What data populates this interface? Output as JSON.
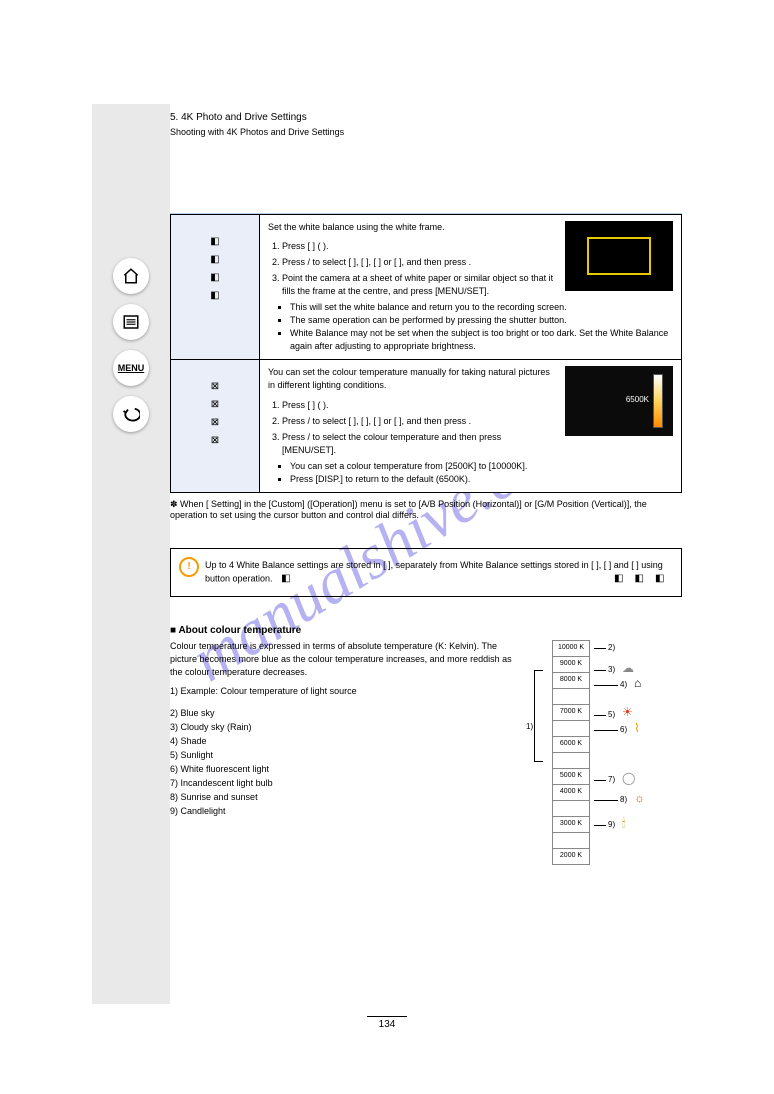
{
  "header": {
    "section": "5. 4K Photo and Drive Settings",
    "sub": "Shooting with 4K Photos and Drive Settings"
  },
  "table": {
    "row1": {
      "labels": [
        "1",
        "2",
        "3",
        "4"
      ],
      "title": "Set the white balance using the white frame.",
      "steps": [
        "Press [ ] ( ).",
        "Press / to select [ ], [ ], [ ] or [ ], and then press .",
        "Point the camera at a sheet of white paper or similar object so that it fills the frame at the centre, and press [MENU/SET].",
        "This will set the white balance and return you to the recording screen.",
        "The same operation can be performed by pressing the shutter button.",
        "White Balance may not be set when the subject is too bright or too dark. Set the White Balance again after adjusting to appropriate brightness."
      ]
    },
    "row2": {
      "labels": [
        "1",
        "2",
        "3",
        "4"
      ],
      "title": "You can set the colour temperature manually for taking natural pictures in different lighting conditions.",
      "steps": [
        "Press [ ] ( ).",
        "Press / to select [ ], [ ], [ ] or [ ], and then press .",
        "Press / to select the colour temperature and then press [MENU/SET].",
        "You can set a colour temperature from [2500K] to [10000K].",
        "Press [DISP.] to return to the default (6500K)."
      ],
      "slider_value": "6500K"
    },
    "footnote": "When [  Setting] in the [Custom] ([Operation]) menu is set to [A/B Position (Horizontal)] or [G/M Position (Vertical)], the operation to set using the cursor button and control dial differs."
  },
  "hint": "Up to 4 White Balance settings are stored in [  ], separately from White Balance settings stored in [ ], [ ] and [ ] using button operation.",
  "kelvin": {
    "heading": "About colour temperature",
    "desc": "Colour temperature is expressed in terms of absolute temperature (K: Kelvin). The picture becomes more blue as the colour temperature increases, and more reddish as the colour temperature decreases.",
    "scale": [
      "10000 K",
      "9000 K",
      "8000 K",
      "",
      "7000 K",
      "",
      "6000 K",
      "",
      "5000 K",
      "4000 K",
      "",
      "3000 K",
      "",
      "2000 K"
    ],
    "items": [
      "Blue sky",
      "Cloudy sky (Rain)",
      "Shade",
      "Sunlight",
      "White fluorescent light",
      "Incandescent light bulb",
      "Sunrise and sunset",
      "Candlelight"
    ],
    "note1": "1) Example: Colour temperature of light source",
    "colors": {
      "blue": "#5c8fe0",
      "red": "#e04020"
    }
  },
  "watermark": "manualshive.com",
  "pagenum": "134",
  "icons": {
    "menu_text": "MENU"
  }
}
